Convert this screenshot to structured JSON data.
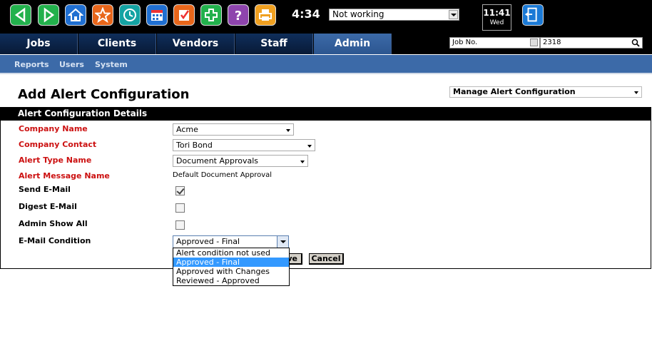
{
  "toolbar": {
    "icons": [
      {
        "name": "back-arrow-icon",
        "color": "#22b14c"
      },
      {
        "name": "forward-arrow-icon",
        "color": "#22b14c"
      },
      {
        "name": "home-icon",
        "color": "#1f6fd1"
      },
      {
        "name": "star-icon",
        "color": "#e8661a"
      },
      {
        "name": "clock-icon",
        "color": "#14a3a3"
      },
      {
        "name": "calendar-icon",
        "color": "#1f6fd1"
      },
      {
        "name": "checklist-icon",
        "color": "#e8661a"
      },
      {
        "name": "plus-icon",
        "color": "#22b14c"
      },
      {
        "name": "help-icon",
        "color": "#8e44ad"
      },
      {
        "name": "printer-icon",
        "color": "#f0a020"
      }
    ],
    "time": "4:34",
    "status_value": "Not working",
    "clock_time": "11:41",
    "clock_day": "Wed",
    "logout_icon": "exit-door-icon"
  },
  "nav": {
    "tabs": [
      "Jobs",
      "Clients",
      "Vendors",
      "Staff",
      "Admin"
    ],
    "active": "Admin"
  },
  "job_search": {
    "field": "Job No.",
    "value": "2318",
    "icon": "search-icon"
  },
  "subnav": [
    "Reports",
    "Users",
    "System"
  ],
  "page": {
    "title": "Add Alert Configuration",
    "manage_select": "Manage Alert Configuration"
  },
  "panel": {
    "header": "Alert Configuration Details"
  },
  "form": {
    "company_name": {
      "label": "Company Name",
      "value": "Acme"
    },
    "company_contact": {
      "label": "Company Contact",
      "value": "Tori Bond"
    },
    "alert_type": {
      "label": "Alert Type Name",
      "value": "Document Approvals"
    },
    "alert_message": {
      "label": "Alert Message Name",
      "value": "Default Document Approval"
    },
    "send_email": {
      "label": "Send E-Mail",
      "checked": true
    },
    "digest_email": {
      "label": "Digest E-Mail",
      "checked": false
    },
    "admin_show_all": {
      "label": "Admin Show All",
      "checked": false
    },
    "email_condition": {
      "label": "E-Mail Condition",
      "value": "Approved - Final",
      "options": [
        "Alert condition not used",
        "Approved - Final",
        "Approved with Changes",
        "Reviewed - Approved"
      ]
    }
  },
  "buttons": {
    "save_partial": "ve",
    "cancel": "Cancel"
  },
  "colors": {
    "nav_dark": "#0f2e5b",
    "nav_active": "#3c6aa8",
    "required": "#cc1111",
    "highlight": "#3399ff"
  }
}
